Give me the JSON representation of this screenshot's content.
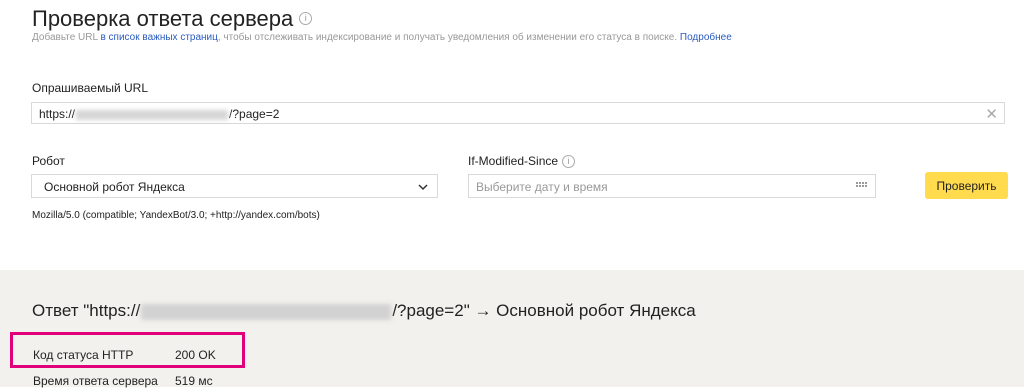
{
  "header": {
    "title": "Проверка ответа сервера",
    "subtitle_prefix": "Добавьте URL ",
    "subtitle_link": "в список важных страниц",
    "subtitle_middle": ", чтобы отслеживать индексирование и получать уведомления об изменении его статуса в поиске. ",
    "more_link": "Подробнее"
  },
  "url_field": {
    "label": "Опрашиваемый URL",
    "value_prefix": "https://",
    "value_suffix": "/?page=2"
  },
  "robot": {
    "label": "Робот",
    "selected": "Основной робот Яндекса",
    "user_agent": "Mozilla/5.0 (compatible; YandexBot/3.0; +http://yandex.com/bots)"
  },
  "if_modified": {
    "label": "If-Modified-Since",
    "placeholder": "Выберите дату и время"
  },
  "check_button": {
    "label": "Проверить"
  },
  "result": {
    "heading_prefix": "Ответ \"https://",
    "heading_suffix": "/?page=2\" → Основной робот Яндекса",
    "rows": [
      {
        "label": "Код статуса HTTP",
        "value": "200 OK"
      },
      {
        "label": "Время ответа сервера",
        "value": "519 мс"
      }
    ]
  },
  "colors": {
    "accent_button": "#ffdb4d",
    "highlight_border": "#e2007a",
    "link": "#2a5bbf",
    "result_bg": "#f3f1ed"
  }
}
